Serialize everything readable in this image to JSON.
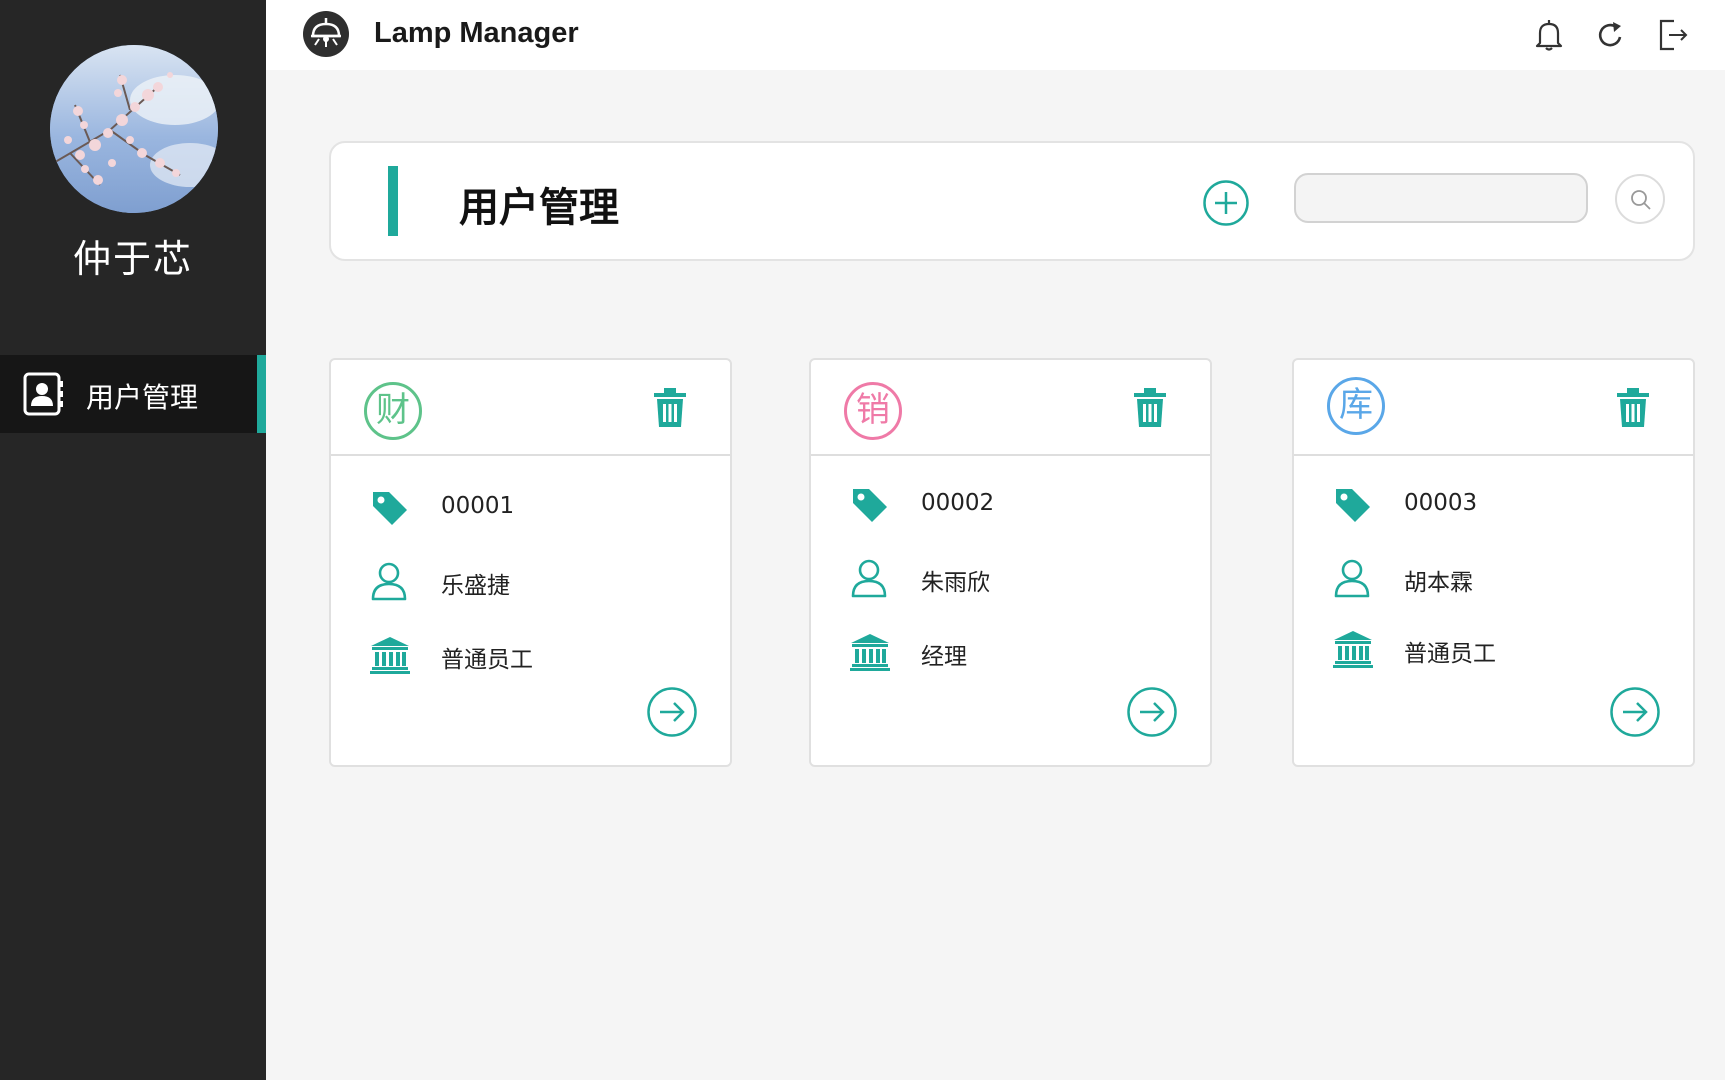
{
  "app": {
    "title": "Lamp Manager",
    "accent_color": "#1fa99b",
    "logo_icon": "lamp-icon"
  },
  "topbar": {
    "icons": [
      "bell-icon",
      "refresh-icon",
      "logout-icon"
    ]
  },
  "sidebar": {
    "profile_name": "仲于芯",
    "items": [
      {
        "label": "用户管理",
        "icon": "contact-book-icon",
        "active": true
      }
    ]
  },
  "header": {
    "title": "用户管理",
    "add_icon": "plus-circle-icon",
    "search": {
      "placeholder": "",
      "value": ""
    },
    "search_icon": "search-icon"
  },
  "users": [
    {
      "dept": "财",
      "dept_color": "#5ec38a",
      "id": "00001",
      "name": "乐盛捷",
      "role": "普通员工"
    },
    {
      "dept": "销",
      "dept_color": "#ef7aa7",
      "id": "00002",
      "name": "朱雨欣",
      "role": "经理"
    },
    {
      "dept": "库",
      "dept_color": "#5aa7e8",
      "id": "00003",
      "name": "胡本霖",
      "role": "普通员工"
    }
  ]
}
